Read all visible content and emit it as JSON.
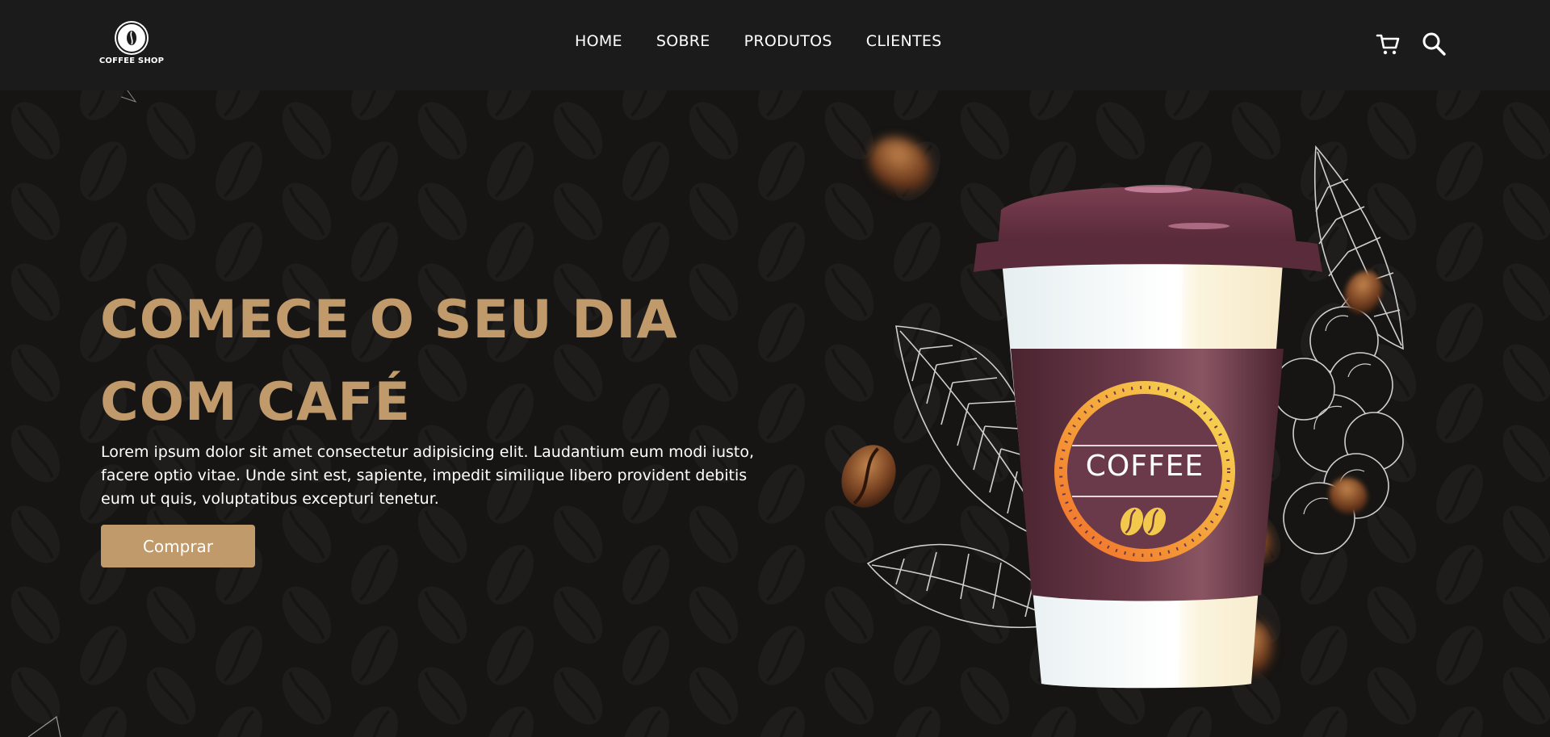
{
  "header": {
    "logo_text": "COFFEE SHOP",
    "nav": [
      "HOME",
      "SOBRE",
      "PRODUTOS",
      "CLIENTES"
    ],
    "icons": [
      "cart-icon",
      "search-icon"
    ]
  },
  "hero": {
    "headline_line1": "COMECE O SEU DIA",
    "headline_line2": "COM CAFÉ",
    "description": "Lorem ipsum dolor sit amet consectetur adipisicing elit. Laudantium eum modi iusto, facere optio vitae. Unde sint est, sapiente, impedit similique libero provident debitis eum ut quis, voluptatibus excepturi tenetur.",
    "button_label": "Comprar",
    "cup_label": "COFFEE"
  },
  "colors": {
    "background": "#161514",
    "header_bg": "#1c1b1b",
    "accent": "#c09a6b",
    "cup_sleeve": "#6b3a4a",
    "cup_lid": "#5a2b3a",
    "badge_gold": "#f2c94c"
  }
}
